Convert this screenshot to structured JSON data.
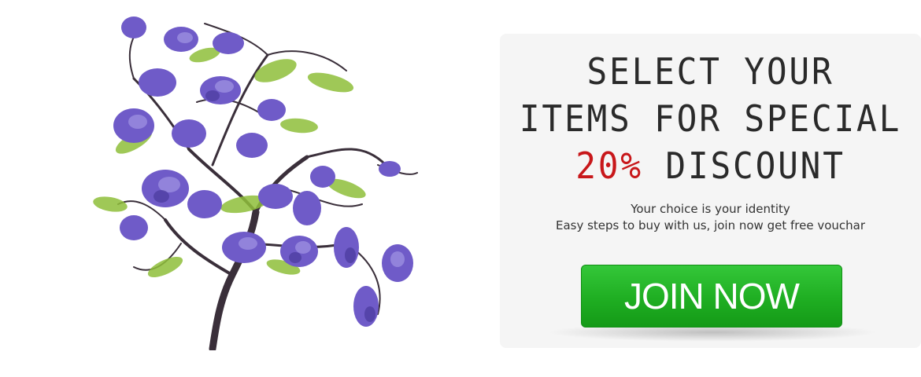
{
  "hero_image": {
    "icon": "wisteria-tree-illustration"
  },
  "promo": {
    "headline_line1": "SELECT YOUR",
    "headline_line2": "ITEMS FOR SPECIAL",
    "discount_value": "20%",
    "discount_word": "DISCOUNT",
    "subtext_line1": "Your choice is your identity",
    "subtext_line2": "Easy steps to buy with us, join now get free vouchar",
    "cta_label": "JOIN NOW"
  },
  "colors": {
    "accent_red": "#c8171a",
    "button_green": "#1fae22",
    "panel_bg": "#f5f5f5",
    "flower_purple": "#6f5bc8",
    "leaf_green": "#8fbf3a"
  }
}
